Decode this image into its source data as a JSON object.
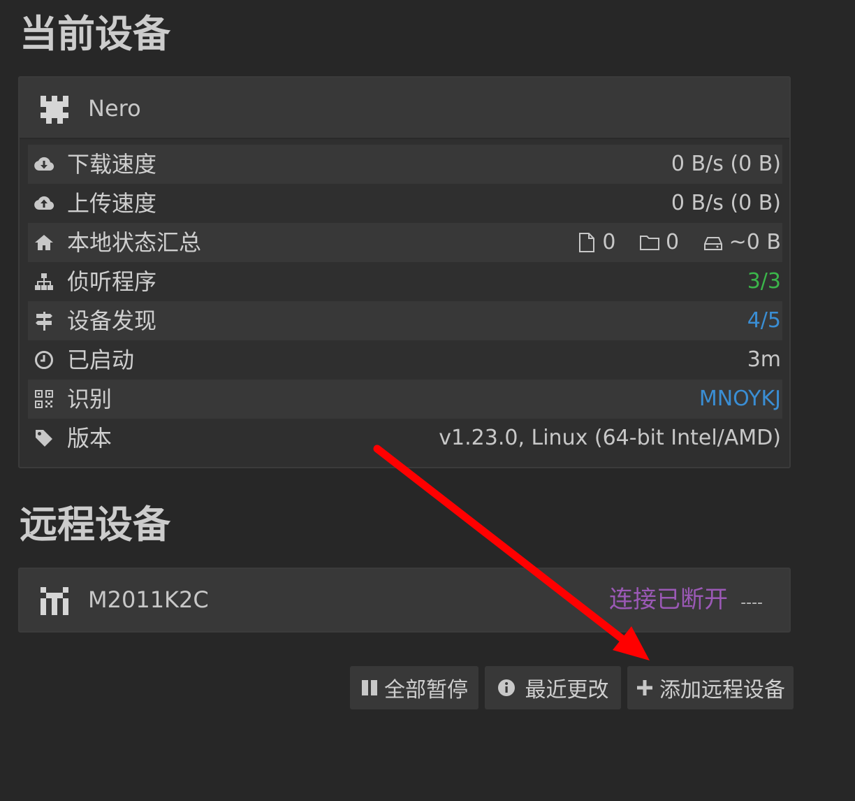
{
  "current_section": {
    "title": "当前设备",
    "device": {
      "name": "Nero",
      "icon": "device-identicon"
    },
    "rows": [
      {
        "label": "下载速度",
        "value": "0 B/s (0 B)",
        "icon": "cloud-download-icon"
      },
      {
        "label": "上传速度",
        "value": "0 B/s (0 B)",
        "icon": "cloud-upload-icon"
      },
      {
        "label": "本地状态汇总",
        "icon": "home-icon",
        "stats": {
          "files": "0",
          "folders": "0",
          "size": "~0 B"
        }
      },
      {
        "label": "侦听程序",
        "value": "3/3",
        "icon": "sitemap-icon",
        "value_color": "#3bb54a"
      },
      {
        "label": "设备发现",
        "value": "4/5",
        "icon": "signpost-icon",
        "value_color": "#3a8ed4"
      },
      {
        "label": "已启动",
        "value": "3m",
        "icon": "clock-icon"
      },
      {
        "label": "识别",
        "value": "MNOYKJ",
        "icon": "qrcode-icon",
        "value_color": "#3a8ed4"
      },
      {
        "label": "版本",
        "value": "v1.23.0, Linux (64-bit Intel/AMD)",
        "icon": "tag-icon"
      }
    ]
  },
  "remote_section": {
    "title": "远程设备",
    "devices": [
      {
        "name": "M2011K2C",
        "status": "连接已断开",
        "status_color": "#9b59b6",
        "extra": "----",
        "icon": "device-identicon"
      }
    ]
  },
  "actions": {
    "pause_all": "全部暂停",
    "recent_changes": "最近更改",
    "add_remote": "添加远程设备"
  },
  "annotation": {
    "arrow_color": "#ff0000"
  }
}
